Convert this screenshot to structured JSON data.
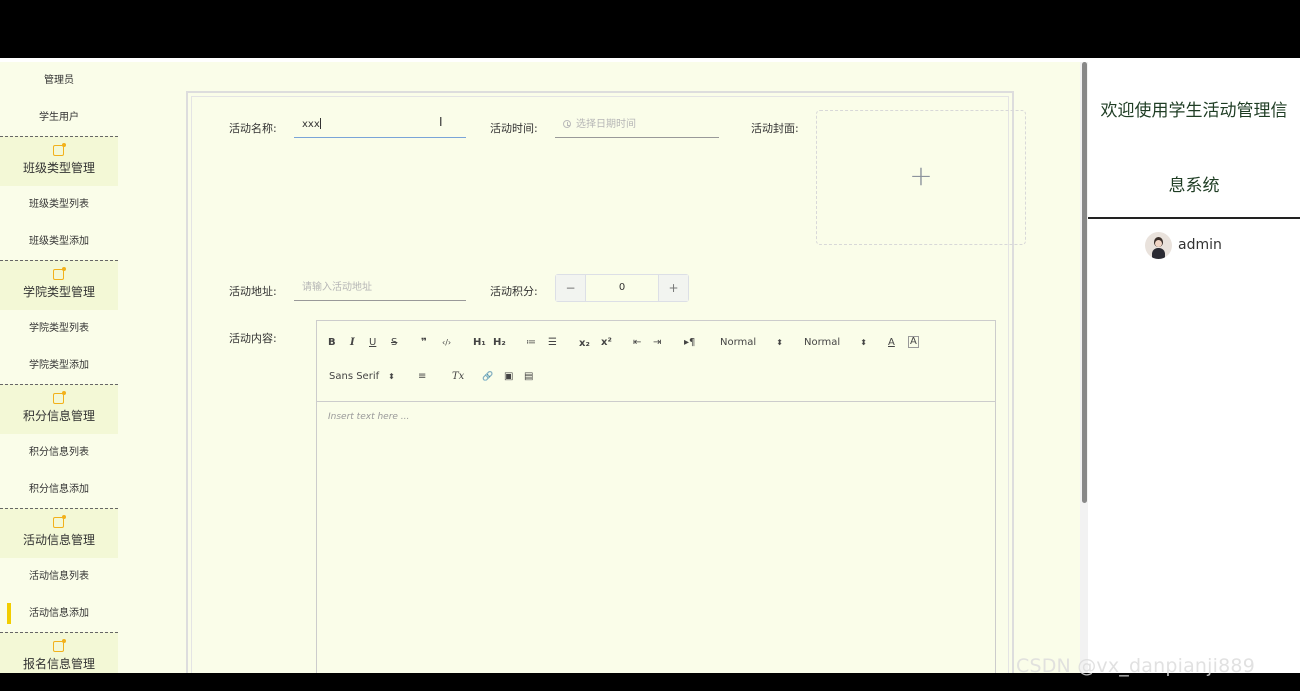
{
  "sidebar": {
    "items": [
      {
        "type": "sub",
        "label": "管理员"
      },
      {
        "type": "sub",
        "label": "学生用户"
      },
      {
        "type": "group",
        "label": "班级类型管理"
      },
      {
        "type": "sub",
        "label": "班级类型列表"
      },
      {
        "type": "sub",
        "label": "班级类型添加"
      },
      {
        "type": "group",
        "label": "学院类型管理"
      },
      {
        "type": "sub",
        "label": "学院类型列表"
      },
      {
        "type": "sub",
        "label": "学院类型添加"
      },
      {
        "type": "group",
        "label": "积分信息管理"
      },
      {
        "type": "sub",
        "label": "积分信息列表"
      },
      {
        "type": "sub",
        "label": "积分信息添加"
      },
      {
        "type": "group",
        "label": "活动信息管理"
      },
      {
        "type": "sub",
        "label": "活动信息列表"
      },
      {
        "type": "sub",
        "label": "活动信息添加",
        "active": true
      },
      {
        "type": "group",
        "label": "报名信息管理"
      }
    ]
  },
  "form": {
    "name_label": "活动名称:",
    "name_value": "xxx",
    "time_label": "活动时间:",
    "time_placeholder": "选择日期时间",
    "cover_label": "活动封面:",
    "cover_plus": "+",
    "address_label": "活动地址:",
    "address_placeholder": "请输入活动地址",
    "points_label": "活动积分:",
    "points_value": "0",
    "points_minus": "−",
    "points_plus": "+",
    "content_label": "活动内容:"
  },
  "editor": {
    "bold": "B",
    "italic": "I",
    "underline": "U",
    "strike": "S",
    "quote": "❞",
    "code": "‹/›",
    "h1": "H₁",
    "h2": "H₂",
    "ordered_list": "≔",
    "bullet_list": "☰",
    "subscript": "x₂",
    "superscript": "x²",
    "outdent": "⇤",
    "indent": "⇥",
    "rtl": "▸¶",
    "size_value": "Normal",
    "header_value": "Normal",
    "font_color": "A",
    "background_color": "A",
    "font_value": "Sans Serif",
    "align": "≡",
    "clean": "Tx",
    "link": "🔗",
    "image": "▣",
    "video": "▤",
    "placeholder": "Insert text here ..."
  },
  "header": {
    "welcome_line1": "欢迎使用学生活动管理信",
    "welcome_line2": "息系统",
    "username": "admin"
  },
  "watermark": "CSDN @vx_danpianji889",
  "colors": {
    "background": "#fafde9",
    "sidebar_group_bg": "#f3f8d6",
    "accent_yellow": "#f2cd00",
    "icon_orange": "#f2b11b"
  }
}
